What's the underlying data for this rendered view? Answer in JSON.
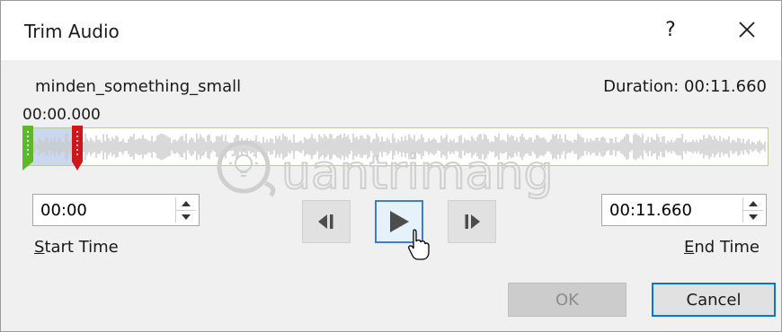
{
  "dialog": {
    "title": "Trim Audio",
    "help_glyph": "?",
    "file_name": "minden_something_small",
    "duration_label": "Duration: 00:11.660",
    "current_time": "00:00.000"
  },
  "start": {
    "value": "00:00",
    "label_accel": "S",
    "label_rest": "tart Time"
  },
  "end": {
    "value": "00:11.660",
    "label_accel": "E",
    "label_rest": "nd Time"
  },
  "buttons": {
    "ok": "OK",
    "cancel": "Cancel"
  },
  "icons": {
    "close": "close-icon",
    "prev_frame": "previous-frame-icon",
    "play": "play-icon",
    "next_frame": "next-frame-icon"
  },
  "watermark": {
    "text": "uantrimang"
  },
  "colors": {
    "start_marker": "#5fb82a",
    "end_marker": "#d0161b",
    "accent": "#0078d7",
    "waveform": "#c9c9c9"
  }
}
